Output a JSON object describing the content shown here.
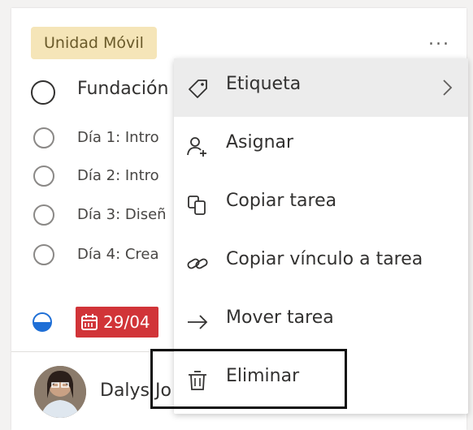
{
  "card": {
    "label": "Unidad Móvil",
    "more_label": "...",
    "title": "Fundación",
    "checklist": [
      {
        "text": "Día 1: Intro"
      },
      {
        "text": "Día 2: Intro"
      },
      {
        "text": "Día 3: Diseñ"
      },
      {
        "text": "Día 4: Crea"
      }
    ],
    "due_date": "29/04",
    "assignee": "Dalys Jo"
  },
  "menu": {
    "items": [
      {
        "label": "Etiqueta",
        "icon": "tag-icon"
      },
      {
        "label": "Asignar",
        "icon": "person-add-icon"
      },
      {
        "label": "Copiar tarea",
        "icon": "copy-icon"
      },
      {
        "label": "Copiar vínculo a tarea",
        "icon": "link-icon"
      },
      {
        "label": "Mover tarea",
        "icon": "arrow-right-icon"
      },
      {
        "label": "Eliminar",
        "icon": "trash-icon"
      }
    ]
  },
  "colors": {
    "label_chip_bg": "#f5e5b8",
    "date_badge_bg": "#d13438",
    "progress": "#1f6fd6",
    "menu_highlight": "#ececec"
  }
}
